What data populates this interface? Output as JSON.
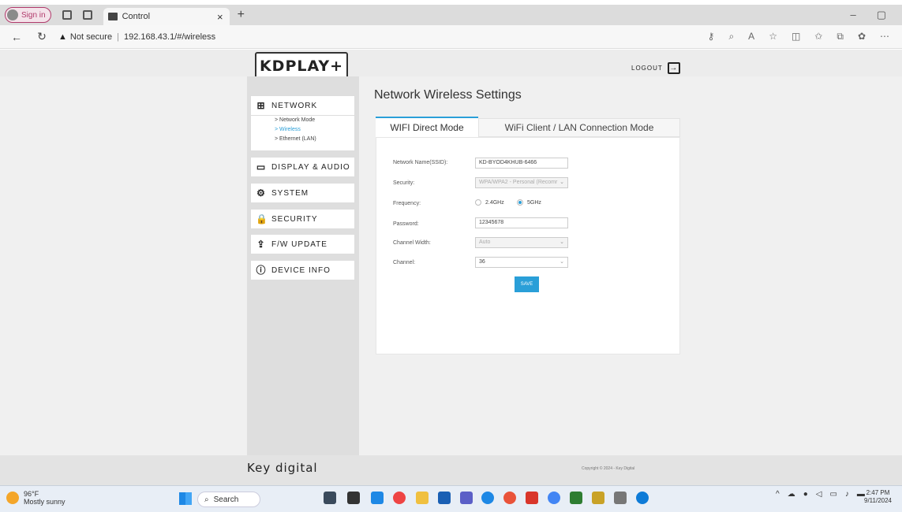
{
  "browser": {
    "signin": "Sign in",
    "tab_title": "Control",
    "tab_close": "×",
    "new_tab": "+",
    "minimize": "–",
    "restore": "▢",
    "not_secure": "Not secure",
    "url": "192.168.43.1/#/wireless"
  },
  "header": {
    "logo": "KDPLAY+",
    "logout": "LOGOUT"
  },
  "sidebar": {
    "items": [
      {
        "label": "NETWORK",
        "icon": "network-icon",
        "glyph": "⊞"
      },
      {
        "label": "DISPLAY & AUDIO",
        "icon": "display-icon",
        "glyph": "▭"
      },
      {
        "label": "SYSTEM",
        "icon": "gear-icon",
        "glyph": "⚙"
      },
      {
        "label": "SECURITY",
        "icon": "lock-icon",
        "glyph": "🔒"
      },
      {
        "label": "F/W UPDATE",
        "icon": "upload-icon",
        "glyph": "⇪"
      },
      {
        "label": "DEVICE INFO",
        "icon": "info-icon",
        "glyph": "ⓘ"
      }
    ],
    "subitems": [
      "> Network Mode",
      "> Wireless",
      "> Ethernet (LAN)"
    ]
  },
  "main": {
    "title": "Network Wireless Settings",
    "tabs": [
      "WIFI Direct Mode",
      "WiFi Client / LAN Connection Mode"
    ],
    "form": {
      "ssid_label": "Network Name(SSID):",
      "ssid_value": "KD-BYOD4KHUB-6466",
      "security_label": "Security:",
      "security_value": "WPA/WPA2 - Personal (Recomr",
      "frequency_label": "Frequency:",
      "freq_options": [
        "2.4GHz",
        "5GHz"
      ],
      "freq_selected": "5GHz",
      "password_label": "Password:",
      "password_value": "12345678",
      "width_label": "Channel Width:",
      "width_value": "Auto",
      "channel_label": "Channel:",
      "channel_value": "36",
      "save_label": "SAVE"
    }
  },
  "footer": {
    "brand": "Key digital",
    "copyright": "Copyright © 2024 - Key Digital"
  },
  "taskbar": {
    "temperature": "96°F",
    "weather": "Mostly sunny",
    "search": "Search",
    "time": "2:47 PM",
    "date": "9/11/2024"
  },
  "colors": {
    "accent": "#2a9fd8"
  }
}
